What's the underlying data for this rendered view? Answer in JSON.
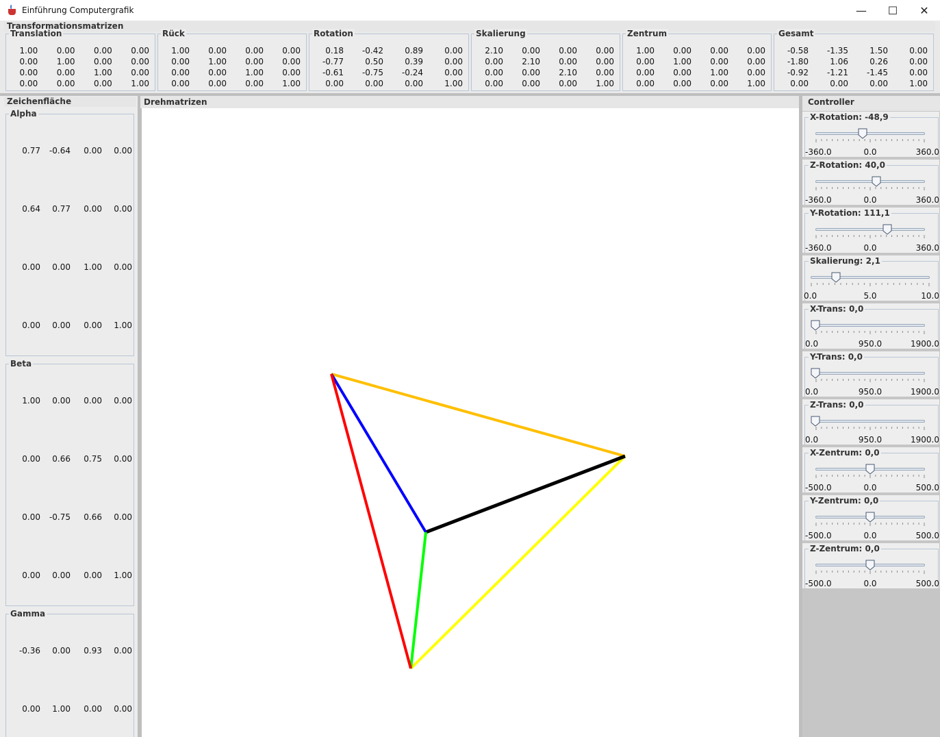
{
  "window": {
    "title": "Einführung Computergrafik",
    "minimize": "—",
    "maximize": "☐",
    "close": "✕"
  },
  "top_panel": {
    "title": "Transformationsmatrizen",
    "matrices": [
      {
        "label": "Translation",
        "values": [
          "1.00",
          "0.00",
          "0.00",
          "0.00",
          "0.00",
          "1.00",
          "0.00",
          "0.00",
          "0.00",
          "0.00",
          "1.00",
          "0.00",
          "0.00",
          "0.00",
          "0.00",
          "1.00"
        ]
      },
      {
        "label": "Rück",
        "values": [
          "1.00",
          "0.00",
          "0.00",
          "0.00",
          "0.00",
          "1.00",
          "0.00",
          "0.00",
          "0.00",
          "0.00",
          "1.00",
          "0.00",
          "0.00",
          "0.00",
          "0.00",
          "1.00"
        ]
      },
      {
        "label": "Rotation",
        "values": [
          "0.18",
          "-0.42",
          "0.89",
          "0.00",
          "-0.77",
          "0.50",
          "0.39",
          "0.00",
          "-0.61",
          "-0.75",
          "-0.24",
          "0.00",
          "0.00",
          "0.00",
          "0.00",
          "1.00"
        ]
      },
      {
        "label": "Skalierung",
        "values": [
          "2.10",
          "0.00",
          "0.00",
          "0.00",
          "0.00",
          "2.10",
          "0.00",
          "0.00",
          "0.00",
          "0.00",
          "2.10",
          "0.00",
          "0.00",
          "0.00",
          "0.00",
          "1.00"
        ]
      },
      {
        "label": "Zentrum",
        "values": [
          "1.00",
          "0.00",
          "0.00",
          "0.00",
          "0.00",
          "1.00",
          "0.00",
          "0.00",
          "0.00",
          "0.00",
          "1.00",
          "0.00",
          "0.00",
          "0.00",
          "0.00",
          "1.00"
        ]
      },
      {
        "label": "Gesamt",
        "values": [
          "-0.58",
          "-1.35",
          "1.50",
          "0.00",
          "-1.80",
          "1.06",
          "0.26",
          "0.00",
          "-0.92",
          "-1.21",
          "-1.45",
          "0.00",
          "0.00",
          "0.00",
          "0.00",
          "1.00"
        ]
      }
    ]
  },
  "left_panel": {
    "title": "Zeichenfläche",
    "alpha": {
      "label": "Alpha",
      "values": [
        "0.77",
        "-0.64",
        "0.00",
        "0.00",
        "0.64",
        "0.77",
        "0.00",
        "0.00",
        "0.00",
        "0.00",
        "1.00",
        "0.00",
        "0.00",
        "0.00",
        "0.00",
        "1.00"
      ]
    },
    "beta": {
      "label": "Beta",
      "values": [
        "1.00",
        "0.00",
        "0.00",
        "0.00",
        "0.00",
        "0.66",
        "0.75",
        "0.00",
        "0.00",
        "-0.75",
        "0.66",
        "0.00",
        "0.00",
        "0.00",
        "0.00",
        "1.00"
      ]
    },
    "gamma": {
      "label": "Gamma",
      "values": [
        "-0.36",
        "0.00",
        "0.93",
        "0.00",
        "0.00",
        "1.00",
        "0.00",
        "0.00"
      ]
    }
  },
  "center_panel": {
    "title": "Drehmatrizen"
  },
  "edge_colors": {
    "orange": "#ffbf00",
    "blue": "#0000ff",
    "red": "#ff0000",
    "black": "#000000",
    "green": "#00ff00",
    "yellow": "#ffff00"
  },
  "controller": {
    "title": "Controller",
    "sliders": [
      {
        "label": "X-Rotation: -48,9",
        "min": "-360.0",
        "mid": "0.0",
        "max": "360.0",
        "value": -48.9,
        "lo": -360,
        "hi": 360
      },
      {
        "label": "Z-Rotation: 40,0",
        "min": "-360.0",
        "mid": "0.0",
        "max": "360.0",
        "value": 40.0,
        "lo": -360,
        "hi": 360
      },
      {
        "label": "Y-Rotation: 111,1",
        "min": "-360.0",
        "mid": "0.0",
        "max": "360.0",
        "value": 111.1,
        "lo": -360,
        "hi": 360
      },
      {
        "label": "Skalierung: 2,1",
        "min": "0.0",
        "mid": "5.0",
        "max": "10.0",
        "value": 2.1,
        "lo": 0,
        "hi": 10
      },
      {
        "label": "X-Trans: 0,0",
        "min": "0.0",
        "mid": "950.0",
        "max": "1900.0",
        "value": 0,
        "lo": 0,
        "hi": 1900
      },
      {
        "label": "Y-Trans: 0,0",
        "min": "0.0",
        "mid": "950.0",
        "max": "1900.0",
        "value": 0,
        "lo": 0,
        "hi": 1900
      },
      {
        "label": "Z-Trans: 0,0",
        "min": "0.0",
        "mid": "950.0",
        "max": "1900.0",
        "value": 0,
        "lo": 0,
        "hi": 1900
      },
      {
        "label": "X-Zentrum: 0,0",
        "min": "-500.0",
        "mid": "0.0",
        "max": "500.0",
        "value": 0,
        "lo": -500,
        "hi": 500
      },
      {
        "label": "Y-Zentrum: 0,0",
        "min": "-500.0",
        "mid": "0.0",
        "max": "500.0",
        "value": 0,
        "lo": -500,
        "hi": 500
      },
      {
        "label": "Z-Zentrum: 0,0",
        "min": "-500.0",
        "mid": "0.0",
        "max": "500.0",
        "value": 0,
        "lo": -500,
        "hi": 500
      }
    ]
  }
}
